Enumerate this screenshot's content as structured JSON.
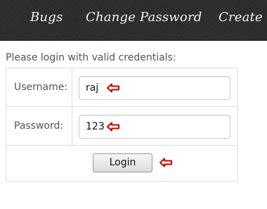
{
  "nav": {
    "items": [
      {
        "label": "Bugs"
      },
      {
        "label": "Change Password"
      },
      {
        "label": "Create"
      }
    ]
  },
  "login": {
    "intro": "Please login with valid credentials:",
    "username_label": "Username:",
    "username_value": "raj",
    "password_label": "Password:",
    "password_value": "123",
    "button_label": "Login"
  },
  "colors": {
    "navbar": "#2e2e2e",
    "annotation_arrow": "#cc0000",
    "border": "#dddddd"
  },
  "icons": [
    "left-arrow-annotation-icon"
  ]
}
